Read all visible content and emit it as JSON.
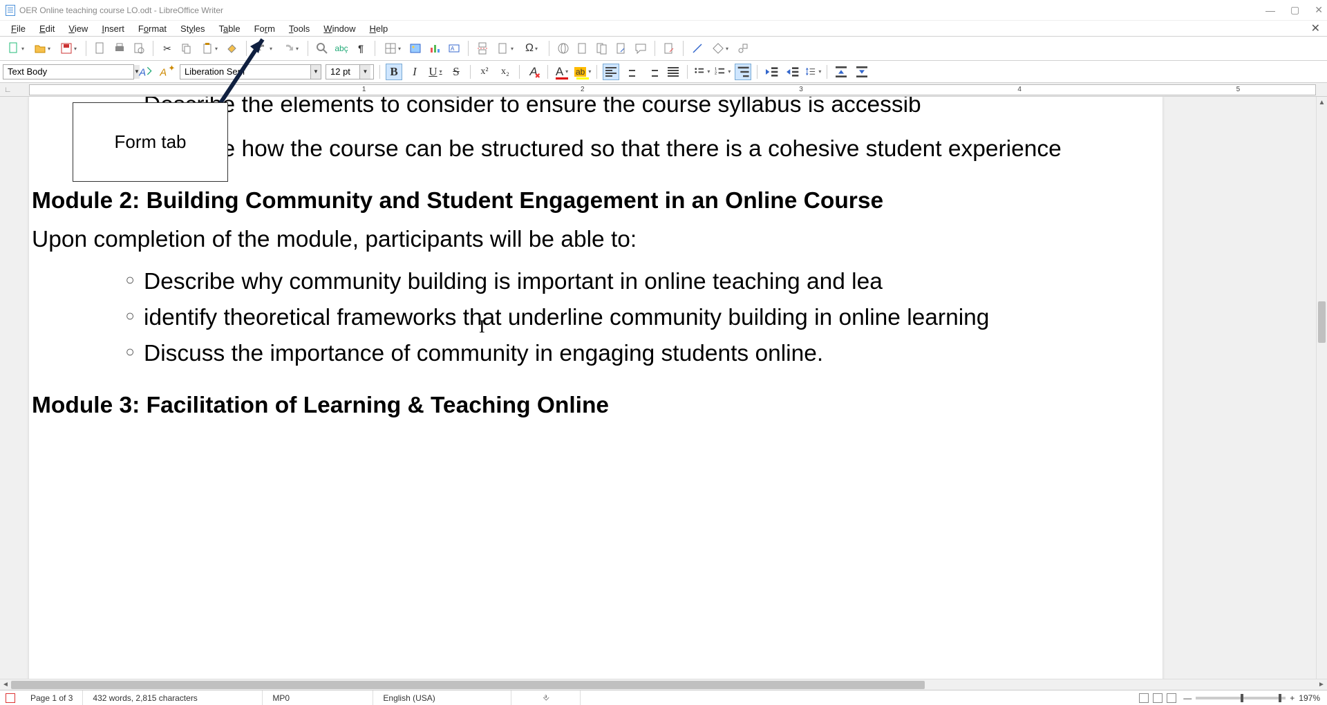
{
  "title": "OER Online teaching course LO.odt - LibreOffice Writer",
  "menu": {
    "file": "File",
    "edit": "Edit",
    "view": "View",
    "insert": "Insert",
    "format": "Format",
    "styles": "Styles",
    "table": "Table",
    "form": "Form",
    "tools": "Tools",
    "window": "Window",
    "help": "Help"
  },
  "callout": {
    "label": "Form tab"
  },
  "format_bar": {
    "para_style": "Text Body",
    "font_name": "Liberation Serif",
    "font_size": "12 pt",
    "bold": "B",
    "italic": "I",
    "underline": "U",
    "strike": "S",
    "superscript": "x²",
    "subscript": "x₂",
    "clear_fmt": "A",
    "font_color": "A",
    "highlight": "ab"
  },
  "ruler": {
    "numbers": [
      "1",
      "2",
      "3",
      "4",
      "5"
    ]
  },
  "document": {
    "cut_item": "Describe the elements to consider to ensure the course syllabus is accessib",
    "item_cohesive": "Describe how the course can be structured so that there is a cohesive student experience",
    "mod2_heading": "Module 2: Building Community and Student Engagement in an Online Course",
    "intro": "Upon completion of the module, participants will be able to:",
    "m2_i1": "Describe why community building is important in online teaching and lea",
    "m2_i2": "identify theoretical frameworks that underline community building in online learning",
    "m2_i3": "Discuss the importance of community in engaging students online.",
    "mod3_heading": "Module 3: Facilitation of Learning & Teaching Online"
  },
  "status": {
    "page": "Page 1 of 3",
    "words": "432 words, 2,815 characters",
    "style": "MP0",
    "lang": "English (USA)",
    "insert_mode": "⎀",
    "zoom_minus": "—",
    "zoom_plus": "+",
    "zoom": "197%"
  }
}
